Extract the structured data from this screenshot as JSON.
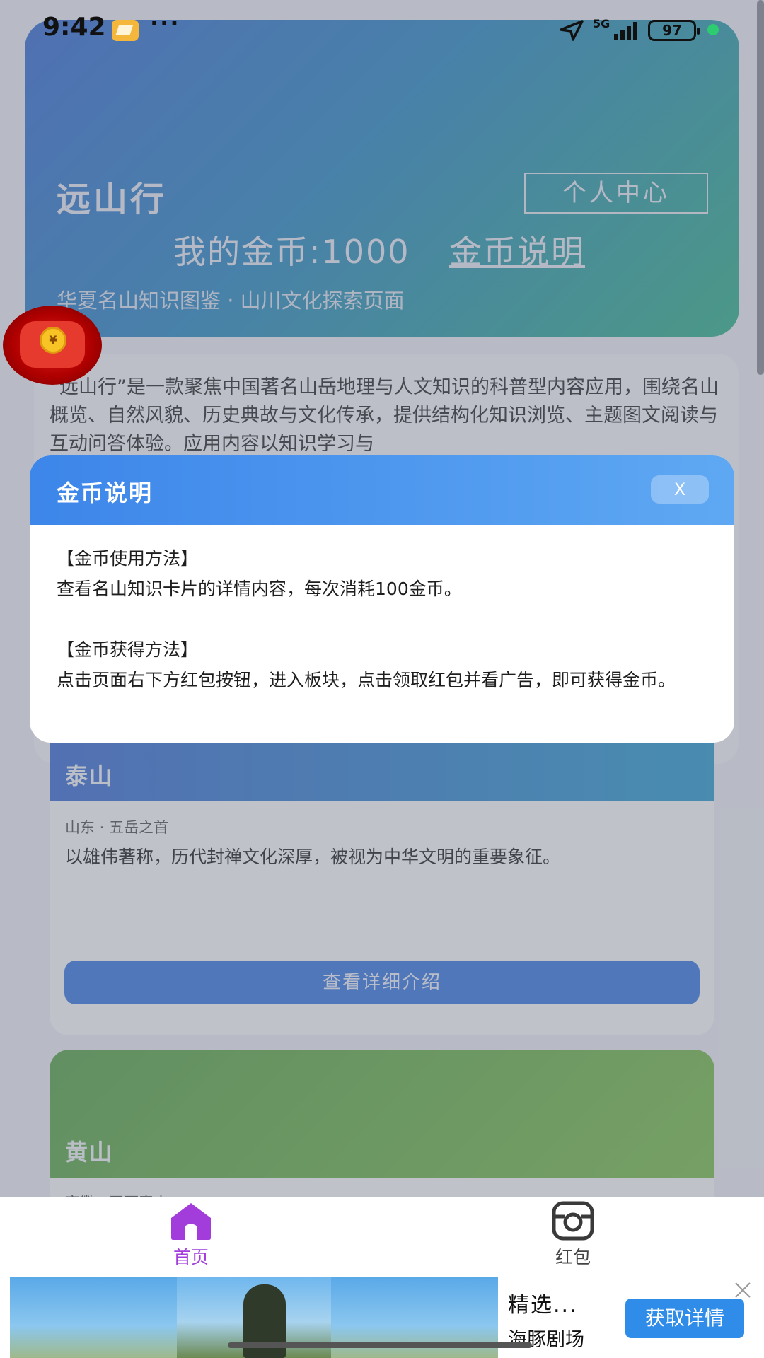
{
  "status_bar": {
    "time": "9:42",
    "dots": "···",
    "network": "5G",
    "battery": "97"
  },
  "header": {
    "app_title": "远山行",
    "profile_button": "个人中心",
    "coins_text": "我的金币:1000",
    "coin_info_link": "金币说明",
    "subtitle": "华夏名山知识图鉴 · 山川文化探索页面"
  },
  "intro": {
    "text": "“远山行”是一款聚焦中国著名山岳地理与人文知识的科普型内容应用，围绕名山概览、自然风貌、历史典故与文化传承，提供结构化知识浏览、主题图文阅读与互动问答体验。应用内容以知识学习与"
  },
  "mountains": [
    {
      "name": "泰山",
      "meta": "山东 · 五岳之首",
      "description": "以雄伟著称，历代封禅文化深厚，被视为中华文明的重要象征。",
      "button": "查看详细介绍"
    },
    {
      "name": "黄山",
      "meta": "安徽 · 天下奇山"
    }
  ],
  "floating": {
    "redpack_coin": "¥"
  },
  "modal": {
    "title": "金币说明",
    "close_label": "X",
    "usage_heading": "【金币使用方法】",
    "usage_text": "查看名山知识卡片的详情内容，每次消耗100金币。",
    "earn_heading": "【金币获得方法】",
    "earn_text": "点击页面右下方红包按钮，进入板块，点击领取红包并看广告，即可获得金币。"
  },
  "tabbar": {
    "tabs": [
      {
        "label": "首页",
        "icon": "home-icon",
        "active": true
      },
      {
        "label": "红包",
        "icon": "camera-icon",
        "active": false
      }
    ],
    "active_color": "#a23ddc"
  },
  "ad": {
    "title": "精选...",
    "source": "海豚剧场",
    "cta": "获取详情"
  },
  "colors": {
    "hero_start": "#3a6fd6",
    "hero_end": "#33b38a",
    "modal_header": "#3d86ea",
    "detail_button": "#3a7be0",
    "ad_cta": "#2f8ce8"
  }
}
